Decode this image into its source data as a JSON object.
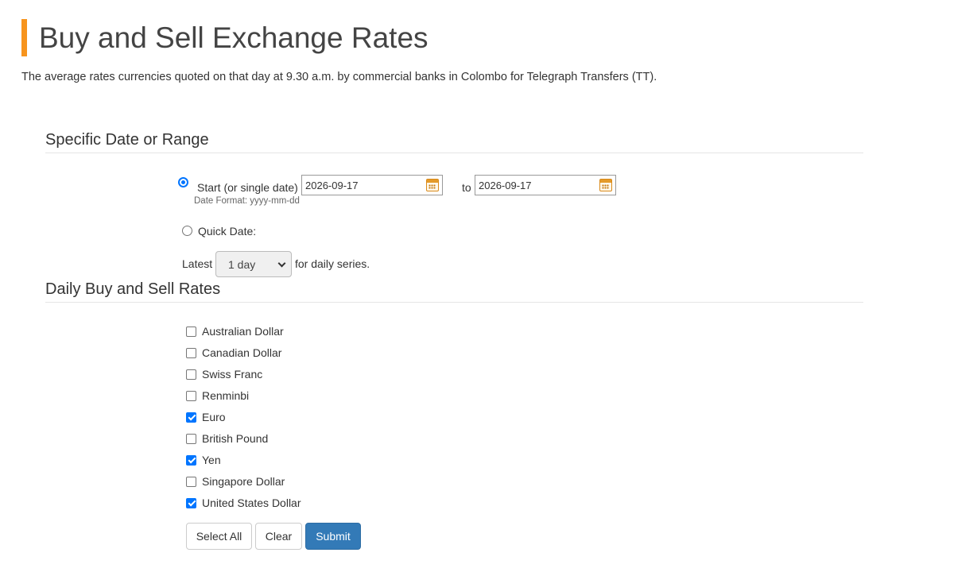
{
  "page": {
    "title": "Buy and Sell Exchange Rates",
    "intro": "The average rates currencies quoted on that day at 9.30 a.m. by commercial banks in Colombo for Telegraph Transfers (TT)."
  },
  "date_section": {
    "heading": "Specific Date or Range",
    "range_radio_label": "Start (or single date)",
    "range_selected": true,
    "start_date": "2026-09-17",
    "to_label": "to",
    "end_date": "2026-09-17",
    "date_format_hint": "Date Format: yyyy-mm-dd",
    "quick_radio_label": "Quick Date:",
    "latest_label": "Latest",
    "latest_value": "1 day",
    "daily_series_label": "for daily series."
  },
  "rates_section": {
    "heading": "Daily Buy and Sell Rates",
    "currencies": [
      {
        "label": "Australian Dollar",
        "checked": false
      },
      {
        "label": "Canadian Dollar",
        "checked": false
      },
      {
        "label": "Swiss Franc",
        "checked": false
      },
      {
        "label": "Renminbi",
        "checked": false
      },
      {
        "label": "Euro",
        "checked": true
      },
      {
        "label": "British Pound",
        "checked": false
      },
      {
        "label": "Yen",
        "checked": true
      },
      {
        "label": "Singapore Dollar",
        "checked": false
      },
      {
        "label": "United States Dollar",
        "checked": true
      }
    ]
  },
  "buttons": {
    "select_all": "Select All",
    "clear": "Clear",
    "submit": "Submit"
  },
  "colors": {
    "accent": "#f7941d",
    "primary": "#337ab7",
    "checkbox": "#0075ff"
  }
}
